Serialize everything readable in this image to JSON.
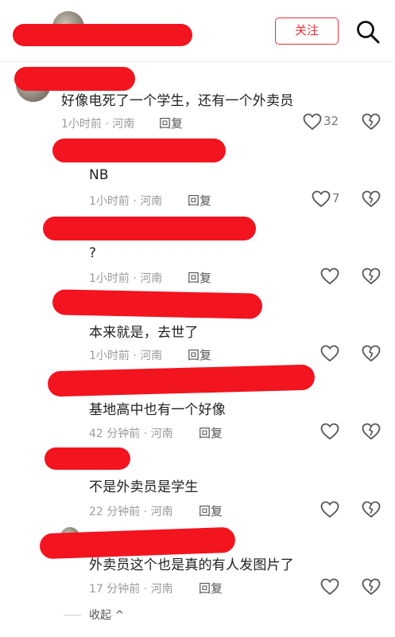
{
  "header": {
    "follow_label": "关注",
    "search_icon": "search-icon"
  },
  "comments": [
    {
      "text": "好像电死了一个学生，还有一个外卖员",
      "time": "1小时前",
      "location": "河南",
      "reply": "回复",
      "likes": "32"
    },
    {
      "text": "NB",
      "time": "1小时前",
      "location": "河南",
      "reply": "回复",
      "likes": "7"
    },
    {
      "text": "?",
      "time": "1小时前",
      "location": "河南",
      "reply": "回复",
      "likes": ""
    },
    {
      "text": "本来就是，去世了",
      "time": "1小时前",
      "location": "河南",
      "reply": "回复",
      "likes": ""
    },
    {
      "text": "基地高中也有一个好像",
      "time": "42 分钟前",
      "location": "河南",
      "reply": "回复",
      "likes": ""
    },
    {
      "text": "不是外卖员是学生",
      "time": "22 分钟前",
      "location": "河南",
      "reply": "回复",
      "likes": ""
    },
    {
      "text": "外卖员这个也是真的有人发图片了",
      "time": "17 分钟前",
      "location": "河南",
      "reply": "回复",
      "likes": ""
    }
  ],
  "meta_separator": " · ",
  "collapse_label": "收起 ^",
  "colors": {
    "accent": "#e5323c",
    "redaction": "#f2141f"
  }
}
